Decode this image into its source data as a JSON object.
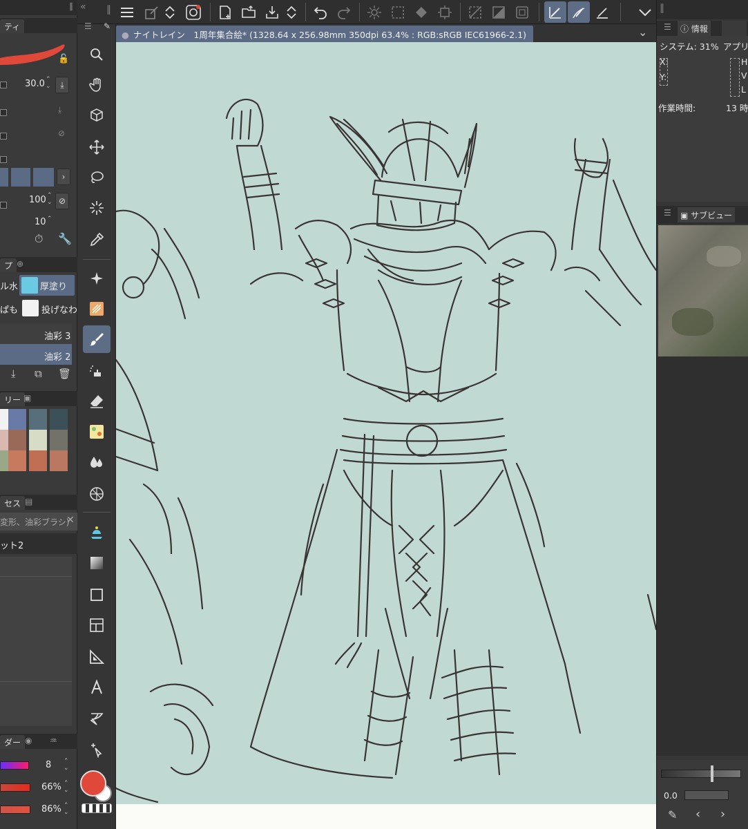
{
  "document": {
    "tab_label": "ナイトレイン　1周年集合絵* (1328.64 x 256.98mm 350dpi 63.4% : RGB:sRGB IEC61966-2.1)"
  },
  "left_panel": {
    "property_tab": "ティ",
    "brush_size_value": "30.0",
    "opacity_value": "100",
    "density_value": "10",
    "sub_tool_tab": "プ",
    "sub_tools": [
      {
        "label": "ル水"
      },
      {
        "label": "厚塗り"
      },
      {
        "label": "ぱも"
      },
      {
        "label": "投げなわ"
      }
    ],
    "brush_items": [
      {
        "label": "油彩 3"
      },
      {
        "label": "油彩 2"
      }
    ],
    "color_set_tab": "リー",
    "history_tab": "セス",
    "history_filter_text": "変形、油彩ブラシ)",
    "history_current": "ット2",
    "layer_tab": "ダー",
    "color_rows": [
      {
        "value": "8"
      },
      {
        "value": "66%"
      },
      {
        "value": "86%"
      }
    ],
    "swatch_colors": [
      "#f2f2f2",
      "#6a7aa6",
      "#566f7a",
      "#3c5058",
      "#d8b8b0",
      "#9a6a58",
      "#d7dcc6",
      "#727268",
      "#9ba888",
      "#c77a5e",
      "#c06f55",
      "#b9785f"
    ],
    "brush_color": "#e0483a"
  },
  "right_panel": {
    "info_tab": "情報",
    "system_label": "システム: 31%",
    "app_label": "アプリ",
    "x_label": "X:",
    "y_label": "Y:",
    "h_label": "H",
    "v_label": "V",
    "l_label": "L",
    "work_time_label": "作業時間:",
    "work_time_value": "13 時",
    "subview_tab": "サブビュー",
    "zoom_value": "0.0"
  }
}
